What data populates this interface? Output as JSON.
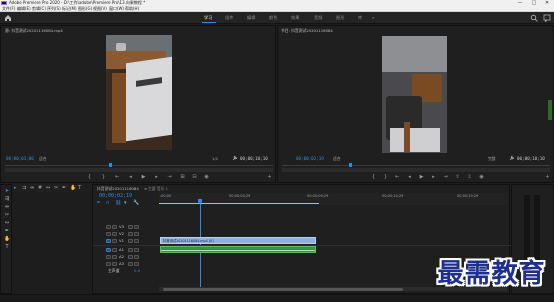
{
  "window": {
    "title": "Adobe Premiere Pro 2020 - D:\\工作\\adobe\\Premiere Pro\\13.向果教程 *",
    "minimize": "—",
    "maximize": "□",
    "close": "✕"
  },
  "menu": [
    "文件(F)",
    "编辑(E)",
    "剪辑(C)",
    "序列(S)",
    "标记(M)",
    "图形(G)",
    "视图(V)",
    "窗口(W)",
    "帮助(H)"
  ],
  "workspaces": {
    "tabs": [
      "学习",
      "组件",
      "编辑",
      "颜色",
      "效果",
      "音频",
      "图形",
      "库"
    ],
    "active_index": 0,
    "menu_glyph": "»"
  },
  "source_monitor": {
    "title": "源: 抖音测试20201116084.mp4",
    "timecode_left": "00;00;03;00",
    "fit": "适合",
    "ratio": "1/2",
    "timecode_right": "00;00;10;10"
  },
  "program_monitor": {
    "title": "节目: 抖音测试20201116084",
    "timecode_left": "00;00;02;19",
    "fit": "适合",
    "ratio": "完整",
    "timecode_right": "00;00;10;10"
  },
  "transport_icons": [
    "mark-in",
    "mark-out",
    "go-to-in",
    "step-back",
    "play",
    "step-forward",
    "go-to-out",
    "insert",
    "overwrite",
    "export-frame",
    "settings",
    "add"
  ],
  "timeline": {
    "tab": "抖音测试20201116084",
    "tab_close": "×",
    "tab2": "主要 音乐 1",
    "timecode": "00;00;02;19",
    "ruler_labels": [
      ":00;00",
      "00;00;04;29",
      "00;00;09;29",
      "00;00;14;29",
      "00;00;19;29"
    ],
    "playhead_time": "00;00;02;19",
    "video_tracks": [
      "V3",
      "V2",
      "V1"
    ],
    "audio_tracks": [
      "A1",
      "A2",
      "A3"
    ],
    "master": "主声道",
    "master_value": "0.0",
    "clip_label": "抖音测试20201116084.mp4 [V]"
  },
  "colors": {
    "accent_blue": "#2d8ceb",
    "clip_blue": "#8fb2dc",
    "audio_green": "#3a8f43",
    "workarea_yellow": "#d8c21f"
  },
  "watermark": "最需教育"
}
